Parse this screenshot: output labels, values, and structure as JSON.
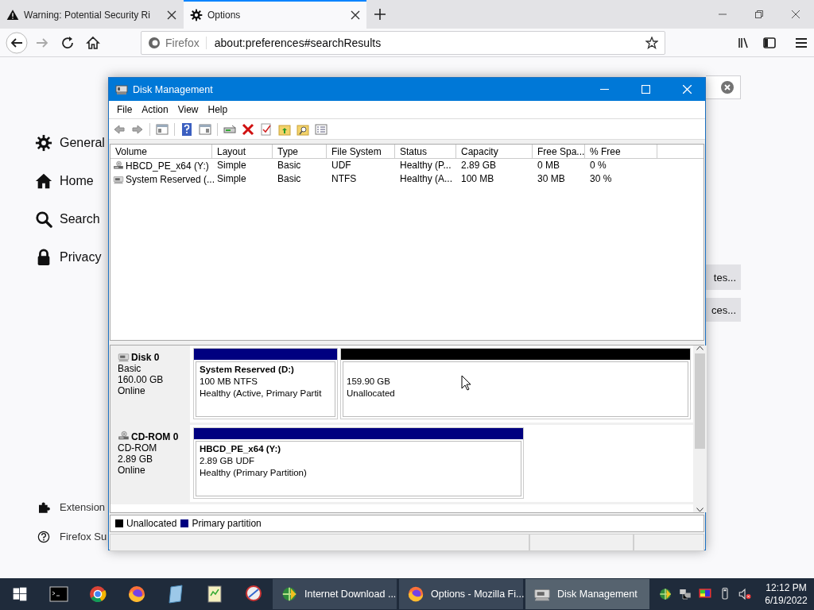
{
  "browser": {
    "tabs": [
      {
        "title": "Warning: Potential Security Ri",
        "selected": false,
        "kind": "warning"
      },
      {
        "title": "Options",
        "selected": true,
        "kind": "settings"
      }
    ],
    "identity": "Firefox",
    "url": "about:preferences#searchResults"
  },
  "preferences": {
    "categories": [
      {
        "label": "General",
        "kind": "general"
      },
      {
        "label": "Home",
        "kind": "home"
      },
      {
        "label": "Search",
        "kind": "search"
      },
      {
        "label": "Privacy",
        "kind": "privacy"
      }
    ],
    "footer_links": [
      {
        "label": "Extension",
        "kind": "extensions"
      },
      {
        "label": "Firefox Su",
        "kind": "support"
      }
    ],
    "buttons": [
      "tes...",
      "ces..."
    ]
  },
  "disk_management": {
    "title": "Disk Management",
    "menu": [
      "File",
      "Action",
      "View",
      "Help"
    ],
    "columns": [
      "Volume",
      "Layout",
      "Type",
      "File System",
      "Status",
      "Capacity",
      "Free Spa...",
      "% Free"
    ],
    "rows": [
      {
        "kind": "cd",
        "cells": [
          "HBCD_PE_x64 (Y:)",
          "Simple",
          "Basic",
          "UDF",
          "Healthy (P...",
          "2.89 GB",
          "0 MB",
          "0 %"
        ]
      },
      {
        "kind": "disk",
        "cells": [
          "System Reserved (...",
          "Simple",
          "Basic",
          "NTFS",
          "Healthy (A...",
          "100 MB",
          "30 MB",
          "30 %"
        ]
      }
    ],
    "disks": [
      {
        "kind": "disk",
        "name": "Disk 0",
        "type": "Basic",
        "size": "160.00 GB",
        "status": "Online",
        "partitions": [
          {
            "color": "#000080",
            "name": "System Reserved  (D:)",
            "detail": "100 MB NTFS",
            "status": "Healthy (Active, Primary Partit"
          },
          {
            "color": "#000000",
            "detail": "159.90 GB",
            "status": "Unallocated"
          }
        ]
      },
      {
        "kind": "cd",
        "name": "CD-ROM 0",
        "type": "CD-ROM",
        "size": "2.89 GB",
        "status": "Online",
        "partitions": [
          {
            "color": "#000080",
            "name": "HBCD_PE_x64  (Y:)",
            "detail": "2.89 GB UDF",
            "status": "Healthy (Primary Partition)"
          }
        ]
      }
    ],
    "legend": [
      {
        "label": "Unallocated",
        "color": "#000000"
      },
      {
        "label": "Primary partition",
        "color": "#000080"
      }
    ]
  },
  "taskbar": {
    "windows": [
      {
        "label": "Internet Download ...",
        "selected": false,
        "kind": "downloader"
      },
      {
        "label": "Options - Mozilla Fi...",
        "selected": false,
        "kind": "firefox"
      },
      {
        "label": "Disk Management",
        "selected": true,
        "kind": "disk"
      }
    ],
    "time": "12:12 PM",
    "date": "6/19/2022"
  }
}
